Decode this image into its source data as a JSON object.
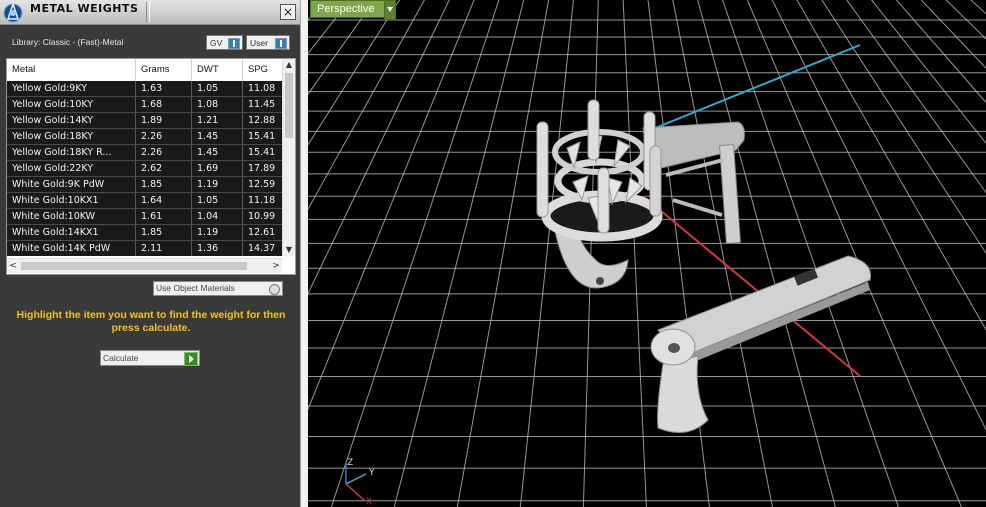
{
  "panel": {
    "title": "METAL WEIGHTS",
    "close_label": "×",
    "library_label": "Library: Classic - (Fast)-Metal",
    "gv_label": "GV",
    "user_label": "User",
    "columns": [
      "Metal",
      "Grams",
      "DWT",
      "SPG"
    ],
    "rows": [
      [
        "Yellow Gold:9KY",
        "1.63",
        "1.05",
        "11.08"
      ],
      [
        "Yellow Gold:10KY",
        "1.68",
        "1.08",
        "11.45"
      ],
      [
        "Yellow Gold:14KY",
        "1.89",
        "1.21",
        "12.88"
      ],
      [
        "Yellow Gold:18KY",
        "2.26",
        "1.45",
        "15.41"
      ],
      [
        "Yellow Gold:18KY R...",
        "2.26",
        "1.45",
        "15.41"
      ],
      [
        "Yellow Gold:22KY",
        "2.62",
        "1.69",
        "17.89"
      ],
      [
        "White Gold:9K PdW",
        "1.85",
        "1.19",
        "12.59"
      ],
      [
        "White Gold:10KX1",
        "1.64",
        "1.05",
        "11.18"
      ],
      [
        "White Gold:10KW",
        "1.61",
        "1.04",
        "10.99"
      ],
      [
        "White Gold:14KX1",
        "1.85",
        "1.19",
        "12.61"
      ],
      [
        "White Gold:14K PdW",
        "2.11",
        "1.36",
        "14.37"
      ]
    ],
    "use_object_materials_label": "Use Object Materials",
    "instructions": "Highlight the item you want to find the weight for then press calculate.",
    "calculate_label": "Calculate"
  },
  "viewport": {
    "view_label": "Perspective",
    "axis_labels": {
      "z": "Z",
      "y": "Y",
      "x": "X"
    },
    "colors": {
      "grid": "#c8c8c8",
      "x_axis": "#d23a3a",
      "y_axis": "#3aa6c8",
      "background": "#000000",
      "model": "#d8d8d8"
    }
  },
  "colors": {
    "panel_bg": "#3a3a3a",
    "instruction_text": "#f3c21b",
    "accent_green": "#7fa64a",
    "table_row_bg": "#1a1a1a"
  },
  "icons": [
    "app-icon",
    "close-icon",
    "dropdown-arrow-icon",
    "scroll-up-icon",
    "scroll-down-icon",
    "scroll-left-icon",
    "scroll-right-icon",
    "calculate-go-icon",
    "axis-gizmo-icon"
  ]
}
